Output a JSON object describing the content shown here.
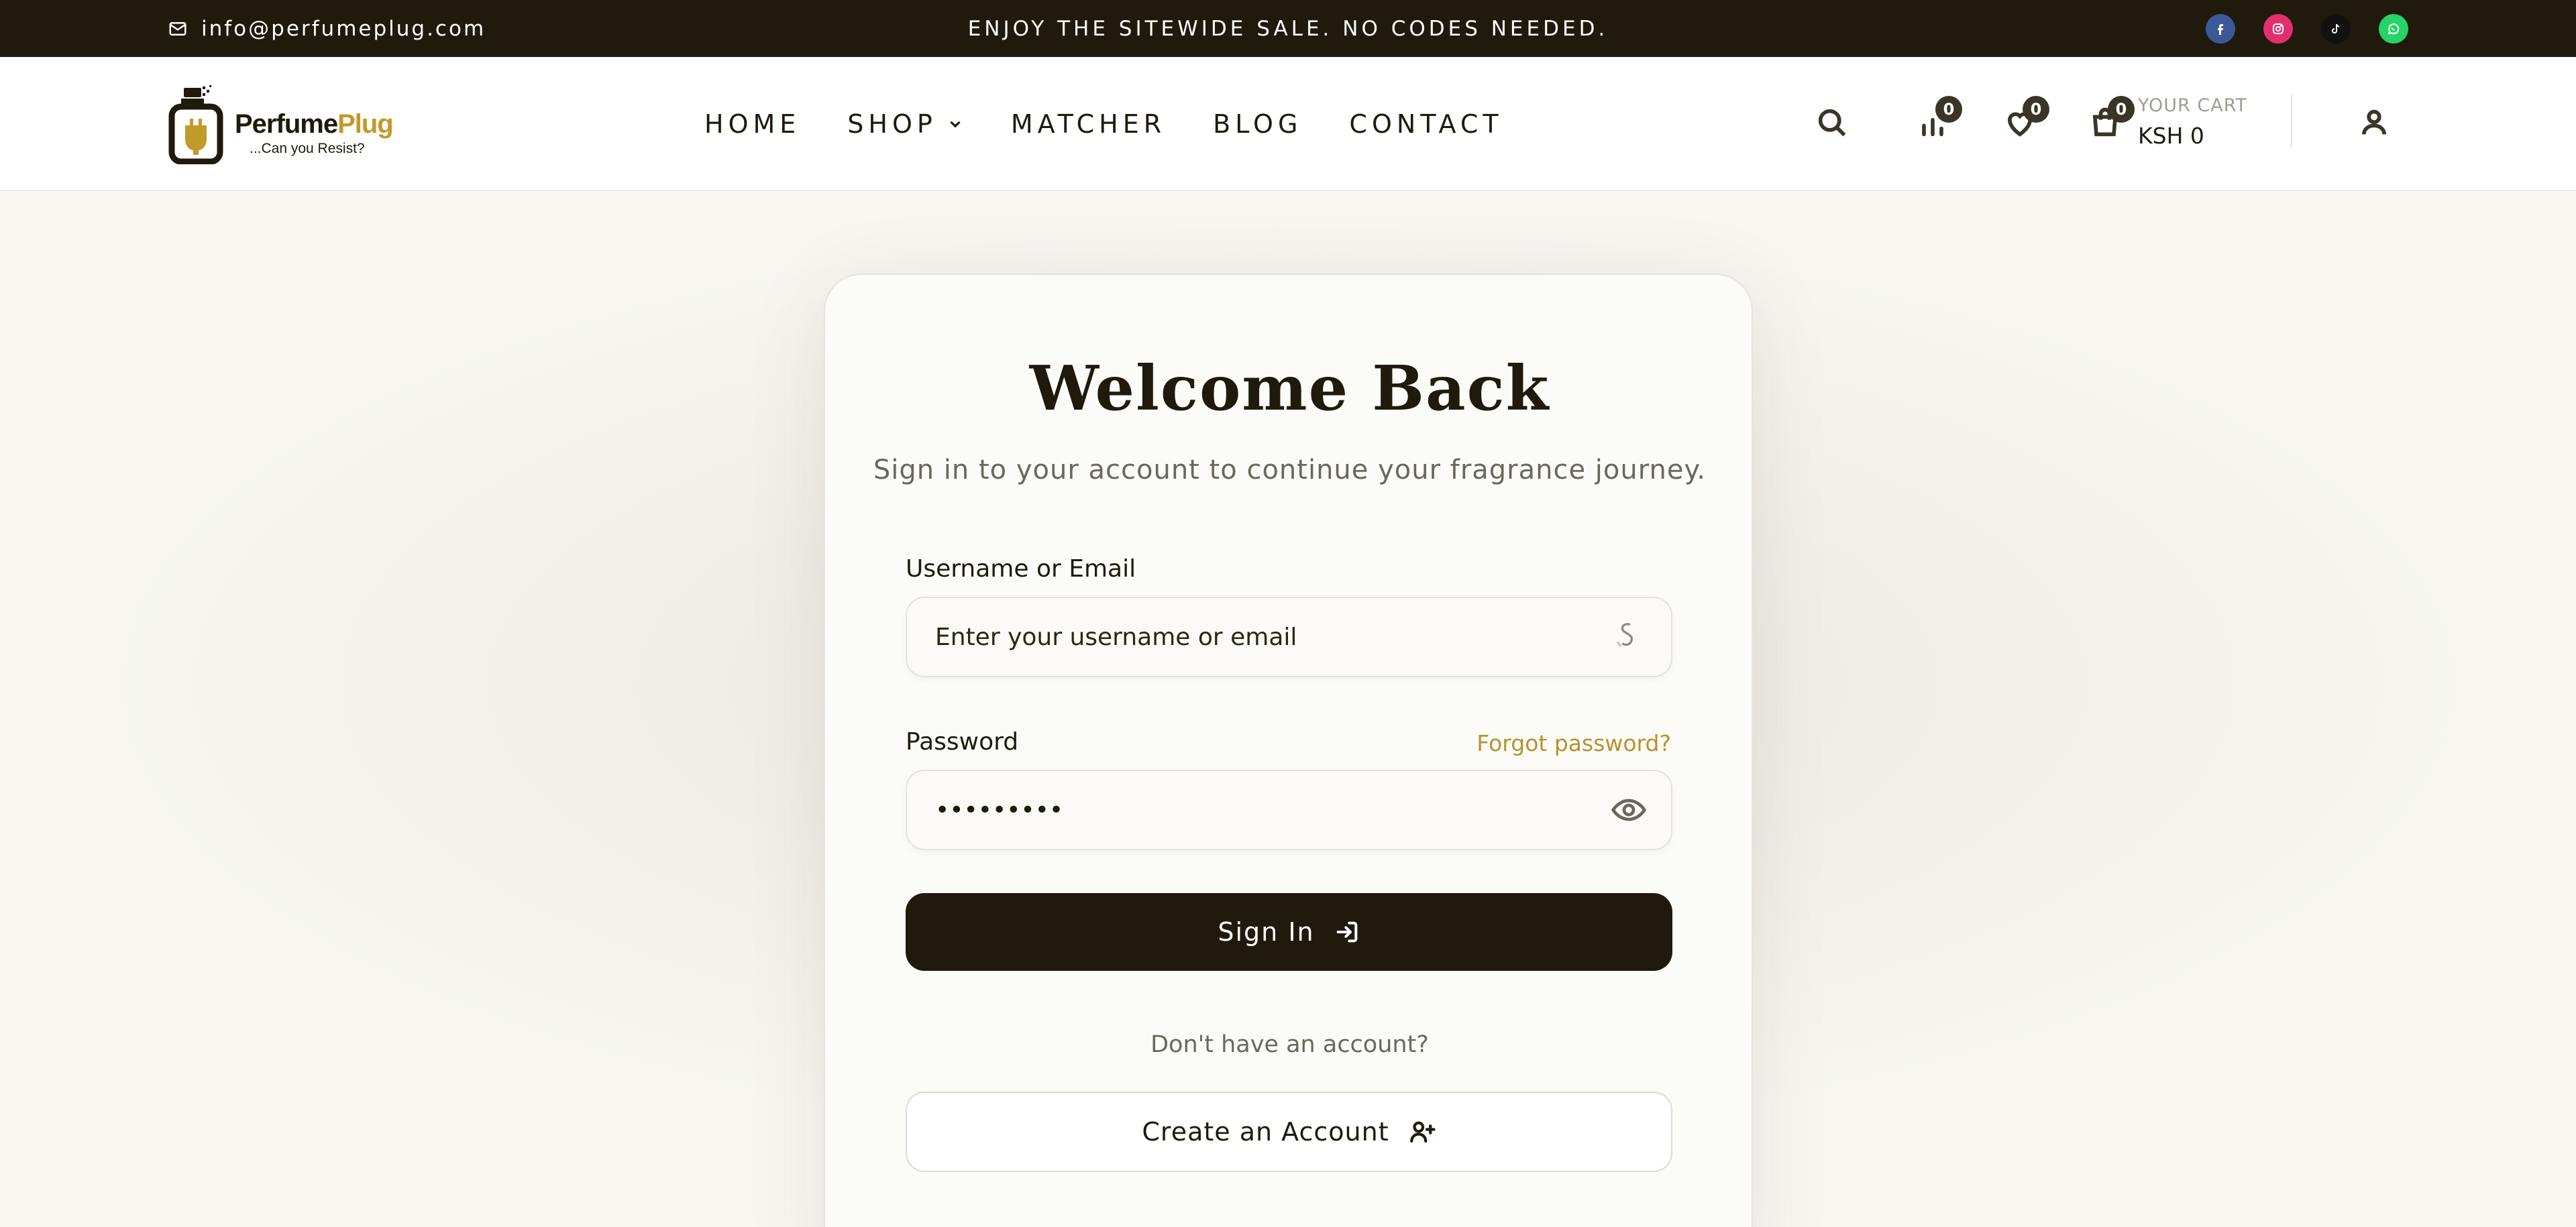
{
  "topbar": {
    "email": "info@perfumeplug.com",
    "promo": "ENJOY THE SITEWIDE SALE. NO CODES NEEDED.",
    "socials": [
      {
        "icon": "facebook-icon",
        "color": "#3b5998"
      },
      {
        "icon": "instagram-icon",
        "color": "#e1306c"
      },
      {
        "icon": "tiktok-icon",
        "color": "#111111"
      },
      {
        "icon": "whatsapp-icon",
        "color": "#25d366"
      }
    ]
  },
  "logo": {
    "brand_part1": "Perfume",
    "brand_part2": "Plug",
    "tagline": "...Can you Resist?"
  },
  "nav": {
    "items": [
      "HOME",
      "SHOP",
      "MATCHER",
      "BLOG",
      "CONTACT"
    ]
  },
  "header": {
    "compare_count": "0",
    "wishlist_count": "0",
    "cart_count": "0",
    "cart_label": "YOUR CART",
    "cart_amount": "KSH 0"
  },
  "login": {
    "title": "Welcome Back",
    "subtitle": "Sign in to your account to continue your fragrance journey.",
    "username_label": "Username or Email",
    "username_placeholder": "Enter your username or email",
    "password_label": "Password",
    "password_value": "•••••••••",
    "forgot_label": "Forgot password?",
    "sign_in_label": "Sign In",
    "no_account_text": "Don't have an account?",
    "create_account_label": "Create an Account"
  },
  "colors": {
    "dark": "#1f1a0c",
    "accent_gold": "#b8922b",
    "background": "#f7f6f1"
  }
}
